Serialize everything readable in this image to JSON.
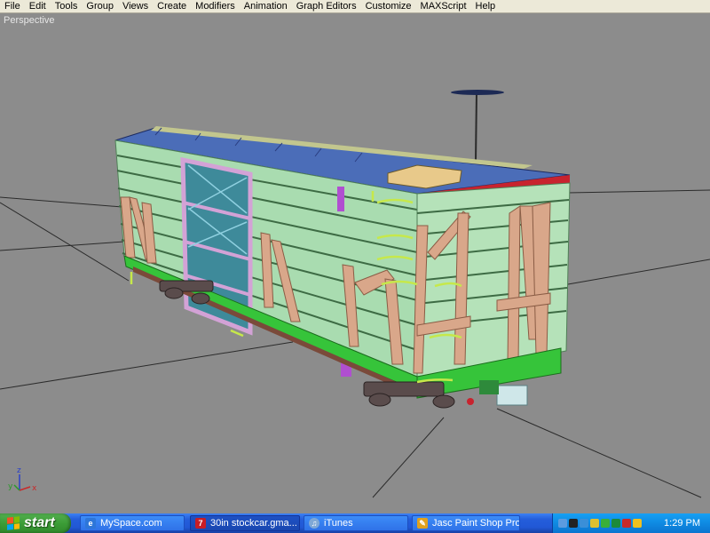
{
  "menubar": {
    "items": [
      "File",
      "Edit",
      "Tools",
      "Group",
      "Views",
      "Create",
      "Modifiers",
      "Animation",
      "Graph Editors",
      "Customize",
      "MAXScript",
      "Help"
    ]
  },
  "viewport": {
    "label": "Perspective",
    "axis_labels": {
      "x": "x",
      "y": "y",
      "z": "z"
    },
    "colors": {
      "background": "#8c8c8c",
      "car_body": "#a9dcb0",
      "car_frame": "#36c43a",
      "bracing": "#d9a78a",
      "door": "#3e8a9a",
      "door_frame": "#d3a2d6",
      "roof": "#4b6db8",
      "roof_red": "#c8232e"
    }
  },
  "taskbar": {
    "start_label": "start",
    "tasks": [
      {
        "label": "MySpace.com",
        "icon": "ie-icon"
      },
      {
        "label": "30in stockcar.gma...",
        "icon": "3dsmax-icon"
      },
      {
        "label": "iTunes",
        "icon": "itunes-icon"
      },
      {
        "label": "Jasc Paint Shop Pro",
        "icon": "paintshop-icon"
      }
    ],
    "clock": "1:29 PM"
  }
}
